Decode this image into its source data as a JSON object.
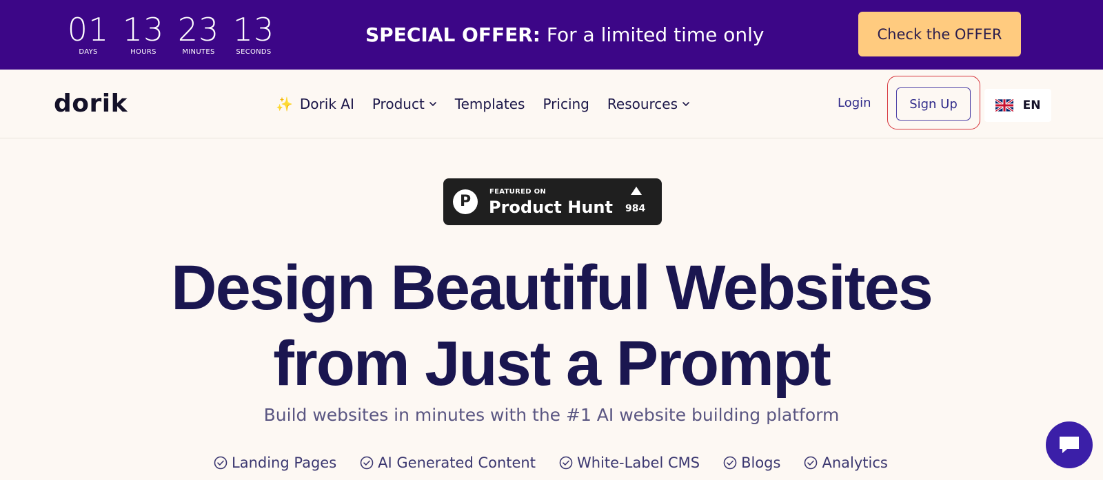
{
  "promo": {
    "countdown": [
      {
        "value": "01",
        "label": "DAYS"
      },
      {
        "value": "13",
        "label": "HOURS"
      },
      {
        "value": "23",
        "label": "MINUTES"
      },
      {
        "value": "13",
        "label": "SECONDS"
      }
    ],
    "offer_strong": "SPECIAL OFFER:",
    "offer_text": " For a limited time only",
    "cta_label": "Check the OFFER",
    "background_color": "#3c0687",
    "cta_color": "#ffcb7f"
  },
  "nav": {
    "logo": "dorik",
    "items": [
      {
        "label": "Dorik AI",
        "icon": "sparkle-icon",
        "dropdown": false
      },
      {
        "label": "Product",
        "icon": "",
        "dropdown": true
      },
      {
        "label": "Templates",
        "icon": "",
        "dropdown": false
      },
      {
        "label": "Pricing",
        "icon": "",
        "dropdown": false
      },
      {
        "label": "Resources",
        "icon": "",
        "dropdown": true
      }
    ],
    "login_label": "Login",
    "signup_label": "Sign Up",
    "language": "EN",
    "language_icon": "uk-flag-icon"
  },
  "hero": {
    "badge": {
      "featured": "FEATURED ON",
      "name": "Product Hunt",
      "logo_letter": "P",
      "upvotes": "984"
    },
    "headline_line1": "Design Beautiful Websites",
    "headline_line2": "from Just a Prompt",
    "subheadline": "Build websites in minutes with the #1 AI website building platform",
    "features": [
      "Landing Pages",
      "AI Generated Content",
      "White-Label CMS",
      "Blogs",
      "Analytics"
    ],
    "accent_color": "#1a1650"
  },
  "chat": {
    "icon": "chat-bubble-icon",
    "color": "#3b1fa8"
  }
}
